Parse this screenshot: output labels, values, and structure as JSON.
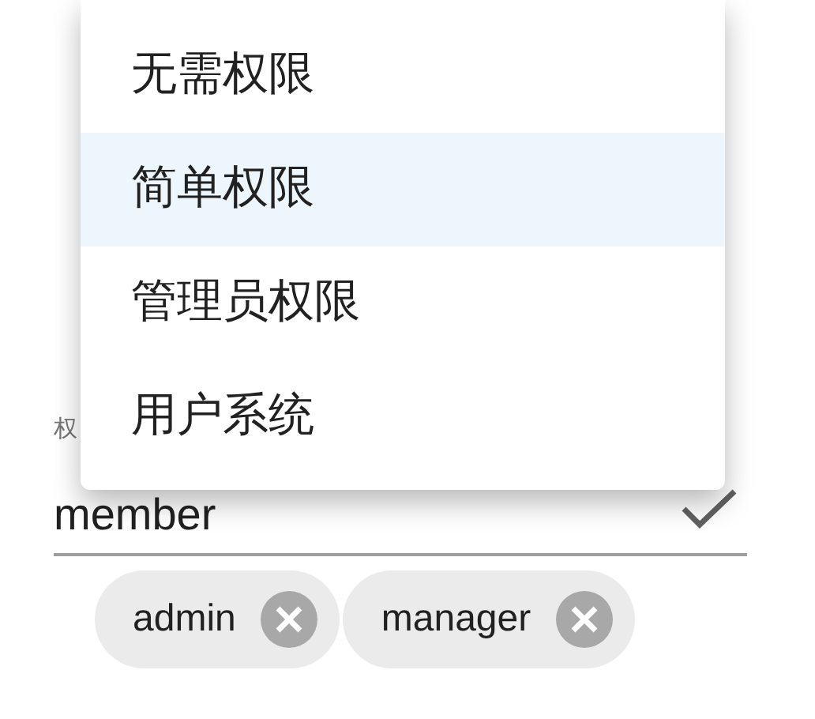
{
  "menu": {
    "items": [
      {
        "label": "无需权限",
        "selected": false
      },
      {
        "label": "简单权限",
        "selected": true
      },
      {
        "label": "管理员权限",
        "selected": false
      },
      {
        "label": "用户系统",
        "selected": false
      }
    ]
  },
  "field": {
    "label": "权",
    "value": "member"
  },
  "chips": [
    {
      "label": "admin"
    },
    {
      "label": "manager"
    }
  ]
}
